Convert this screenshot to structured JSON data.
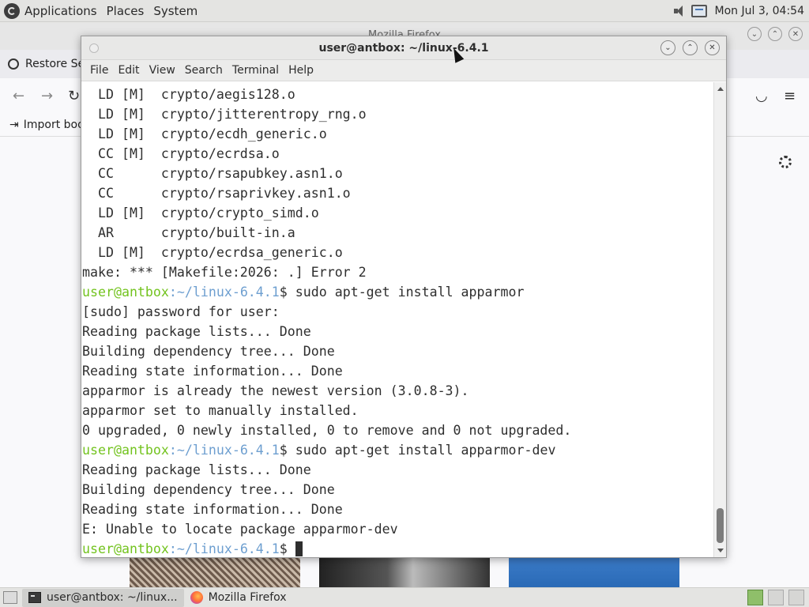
{
  "top_panel": {
    "menus": [
      "Applications",
      "Places",
      "System"
    ],
    "clock": "Mon Jul 3, 04:54"
  },
  "firefox": {
    "window_title": "Mozilla Firefox",
    "restore_label": "Restore Se",
    "bookmarks_label": "Import boo"
  },
  "terminal": {
    "title": "user@antbox: ~/linux-6.4.1",
    "menus": [
      "File",
      "Edit",
      "View",
      "Search",
      "Terminal",
      "Help"
    ],
    "prompt_user": "user@antbox",
    "prompt_path": ":~/linux-6.4.1",
    "prompt_symbol": "$ ",
    "lines": [
      {
        "kind": "out",
        "text": "  LD [M]  crypto/aegis128.o"
      },
      {
        "kind": "out",
        "text": "  LD [M]  crypto/jitterentropy_rng.o"
      },
      {
        "kind": "out",
        "text": "  LD [M]  crypto/ecdh_generic.o"
      },
      {
        "kind": "out",
        "text": "  CC [M]  crypto/ecrdsa.o"
      },
      {
        "kind": "out",
        "text": "  CC      crypto/rsapubkey.asn1.o"
      },
      {
        "kind": "out",
        "text": "  CC      crypto/rsaprivkey.asn1.o"
      },
      {
        "kind": "out",
        "text": "  LD [M]  crypto/crypto_simd.o"
      },
      {
        "kind": "out",
        "text": "  AR      crypto/built-in.a"
      },
      {
        "kind": "out",
        "text": "  LD [M]  crypto/ecrdsa_generic.o"
      },
      {
        "kind": "out",
        "text": "make: *** [Makefile:2026: .] Error 2"
      },
      {
        "kind": "cmd",
        "text": "sudo apt-get install apparmor"
      },
      {
        "kind": "out",
        "text": "[sudo] password for user:"
      },
      {
        "kind": "out",
        "text": "Reading package lists... Done"
      },
      {
        "kind": "out",
        "text": "Building dependency tree... Done"
      },
      {
        "kind": "out",
        "text": "Reading state information... Done"
      },
      {
        "kind": "out",
        "text": "apparmor is already the newest version (3.0.8-3)."
      },
      {
        "kind": "out",
        "text": "apparmor set to manually installed."
      },
      {
        "kind": "out",
        "text": "0 upgraded, 0 newly installed, 0 to remove and 0 not upgraded."
      },
      {
        "kind": "cmd",
        "text": "sudo apt-get install apparmor-dev"
      },
      {
        "kind": "out",
        "text": "Reading package lists... Done"
      },
      {
        "kind": "out",
        "text": "Building dependency tree... Done"
      },
      {
        "kind": "out",
        "text": "Reading state information... Done"
      },
      {
        "kind": "out",
        "text": "E: Unable to locate package apparmor-dev"
      },
      {
        "kind": "cmd",
        "text": ""
      }
    ]
  },
  "taskbar": {
    "items": [
      {
        "label": "user@antbox: ~/linux...",
        "icon": "terminal-icon"
      },
      {
        "label": "Mozilla Firefox",
        "icon": "firefox-icon"
      }
    ]
  },
  "colors": {
    "prompt_user": "#73c31f",
    "prompt_path": "#6e9fd0",
    "terminal_bg": "#ffffff",
    "terminal_fg": "#2e2e2e"
  }
}
